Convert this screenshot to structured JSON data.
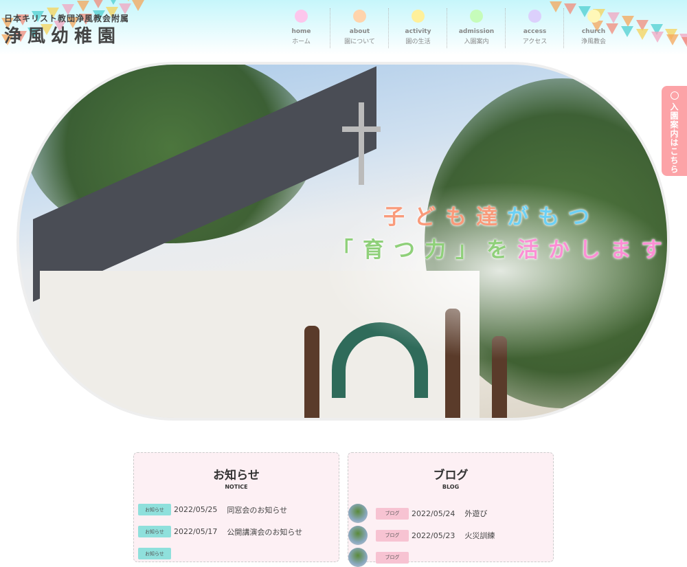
{
  "header": {
    "logo_sub": "日本キリスト教団浄風教会附属",
    "logo_main": "浄風幼稚園",
    "nav": [
      {
        "en": "home",
        "ja": "ホーム",
        "color": "#fcc6ec"
      },
      {
        "en": "about",
        "ja": "園について",
        "color": "#ffd4ac"
      },
      {
        "en": "activity",
        "ja": "園の生活",
        "color": "#fff09a"
      },
      {
        "en": "admission",
        "ja": "入園案内",
        "color": "#c6fcba"
      },
      {
        "en": "access",
        "ja": "アクセス",
        "color": "#dcd0fc"
      },
      {
        "en": "church",
        "ja": "浄風教会",
        "color": "#fff8b8"
      }
    ]
  },
  "hero": {
    "line1": [
      {
        "t": "子ども達",
        "c": "#f99a7a"
      },
      {
        "t": "がもつ",
        "c": "#6dd0f4"
      }
    ],
    "line2": [
      {
        "t": "「育つ力」を",
        "c": "#8fd07a"
      },
      {
        "t": "活かします",
        "c": "#fb8fd4"
      }
    ]
  },
  "side_tab": {
    "label": "入園案内はこちら",
    "icon": "baby-face-icon",
    "color": "#fca3a7"
  },
  "notice": {
    "title": "お知らせ",
    "subtitle": "NOTICE",
    "badge_color": "#8fe0dc",
    "items": [
      {
        "badge": "お知らせ",
        "date": "2022/05/25",
        "title": "同窓会のお知らせ"
      },
      {
        "badge": "お知らせ",
        "date": "2022/05/17",
        "title": "公開講演会のお知らせ"
      },
      {
        "badge": "お知らせ",
        "date": "",
        "title": ""
      }
    ]
  },
  "blog": {
    "title": "ブログ",
    "subtitle": "BLOG",
    "badge_color": "#f7c3d2",
    "items": [
      {
        "badge": "ブログ",
        "date": "2022/05/24",
        "title": "外遊び"
      },
      {
        "badge": "ブログ",
        "date": "2022/05/23",
        "title": "火災訓練"
      },
      {
        "badge": "ブログ",
        "date": "",
        "title": ""
      }
    ]
  }
}
